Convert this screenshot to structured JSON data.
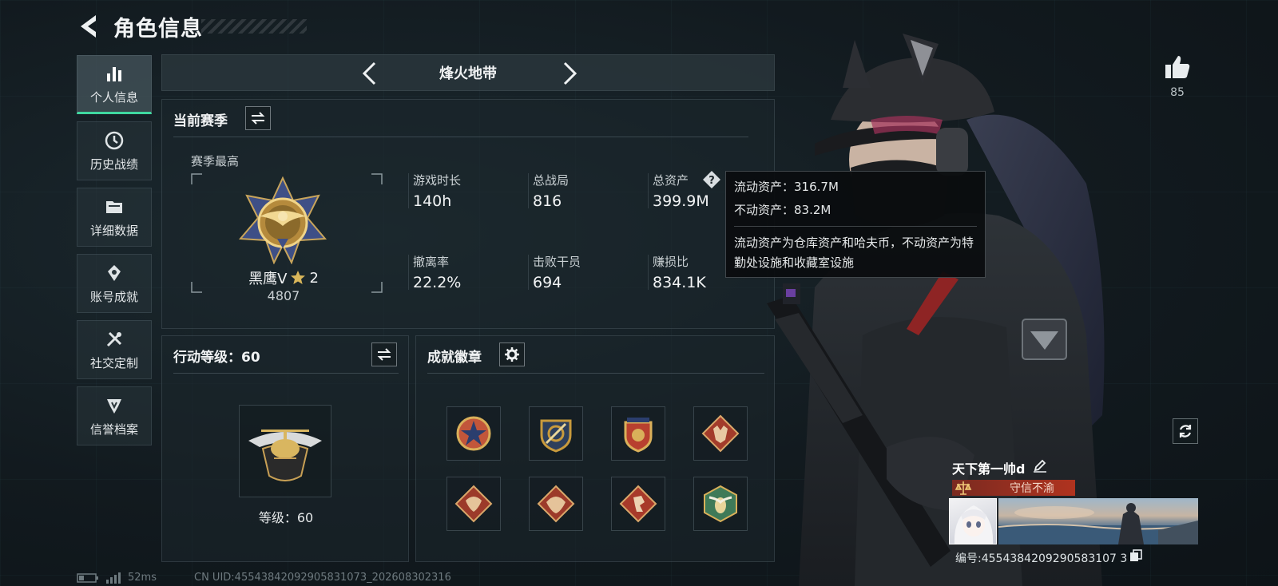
{
  "header": {
    "title": "角色信息"
  },
  "nav": {
    "items": [
      {
        "label": "个人信息",
        "icon": "bar-chart-icon",
        "active": true
      },
      {
        "label": "历史战绩",
        "icon": "history-icon",
        "active": false
      },
      {
        "label": "详细数据",
        "icon": "folder-icon",
        "active": false
      },
      {
        "label": "账号成就",
        "icon": "achievement-icon",
        "active": false
      },
      {
        "label": "社交定制",
        "icon": "tools-icon",
        "active": false
      },
      {
        "label": "信誉档案",
        "icon": "credit-icon",
        "active": false
      }
    ]
  },
  "mode": {
    "title": "烽火地带"
  },
  "season": {
    "heading": "当前赛季",
    "best_label": "赛季最高",
    "rank_name": "黑鹰V",
    "rank_stars": "2",
    "rank_points": "4807",
    "stats": [
      {
        "label": "游戏时长",
        "value": "140h"
      },
      {
        "label": "总战局",
        "value": "816"
      },
      {
        "label": "总资产",
        "value": "399.9M"
      },
      {
        "label": "撤离率",
        "value": "22.2%"
      },
      {
        "label": "击败干员",
        "value": "694"
      },
      {
        "label": "赚损比",
        "value": "834.1K"
      }
    ]
  },
  "tooltip": {
    "liquid": "流动资产：316.7M",
    "fixed": "不动资产：83.2M",
    "desc": "流动资产为仓库资产和哈夫币，不动资产为特勤处设施和收藏室设施"
  },
  "action_level": {
    "heading": "行动等级：60",
    "level_text": "等级：60"
  },
  "badges": {
    "heading": "成就徽章",
    "items": [
      {
        "icon": "star-shield-badge-icon",
        "color": "#c2563a"
      },
      {
        "icon": "target-shield-badge-icon",
        "color": "#c89a3c"
      },
      {
        "icon": "wing-shield-badge-icon",
        "color": "#b8402f"
      },
      {
        "icon": "wolf-badge-icon",
        "color": "#a33c2b"
      },
      {
        "icon": "dragon-badge-icon",
        "color": "#9c3a2a"
      },
      {
        "icon": "dragon-badge-icon-2",
        "color": "#9c3a2a"
      },
      {
        "icon": "runner-badge-icon",
        "color": "#a83a2a"
      },
      {
        "icon": "wasp-badge-icon",
        "color": "#3f7a58"
      }
    ]
  },
  "profile": {
    "likes": "85",
    "player_name": "天下第一帅d",
    "title": "守信不渝",
    "uid": "编号:4554384209290583107 3"
  },
  "status": {
    "ping": "52ms",
    "cn_uid": "CN UID:45543842092905831073_202608302316"
  }
}
